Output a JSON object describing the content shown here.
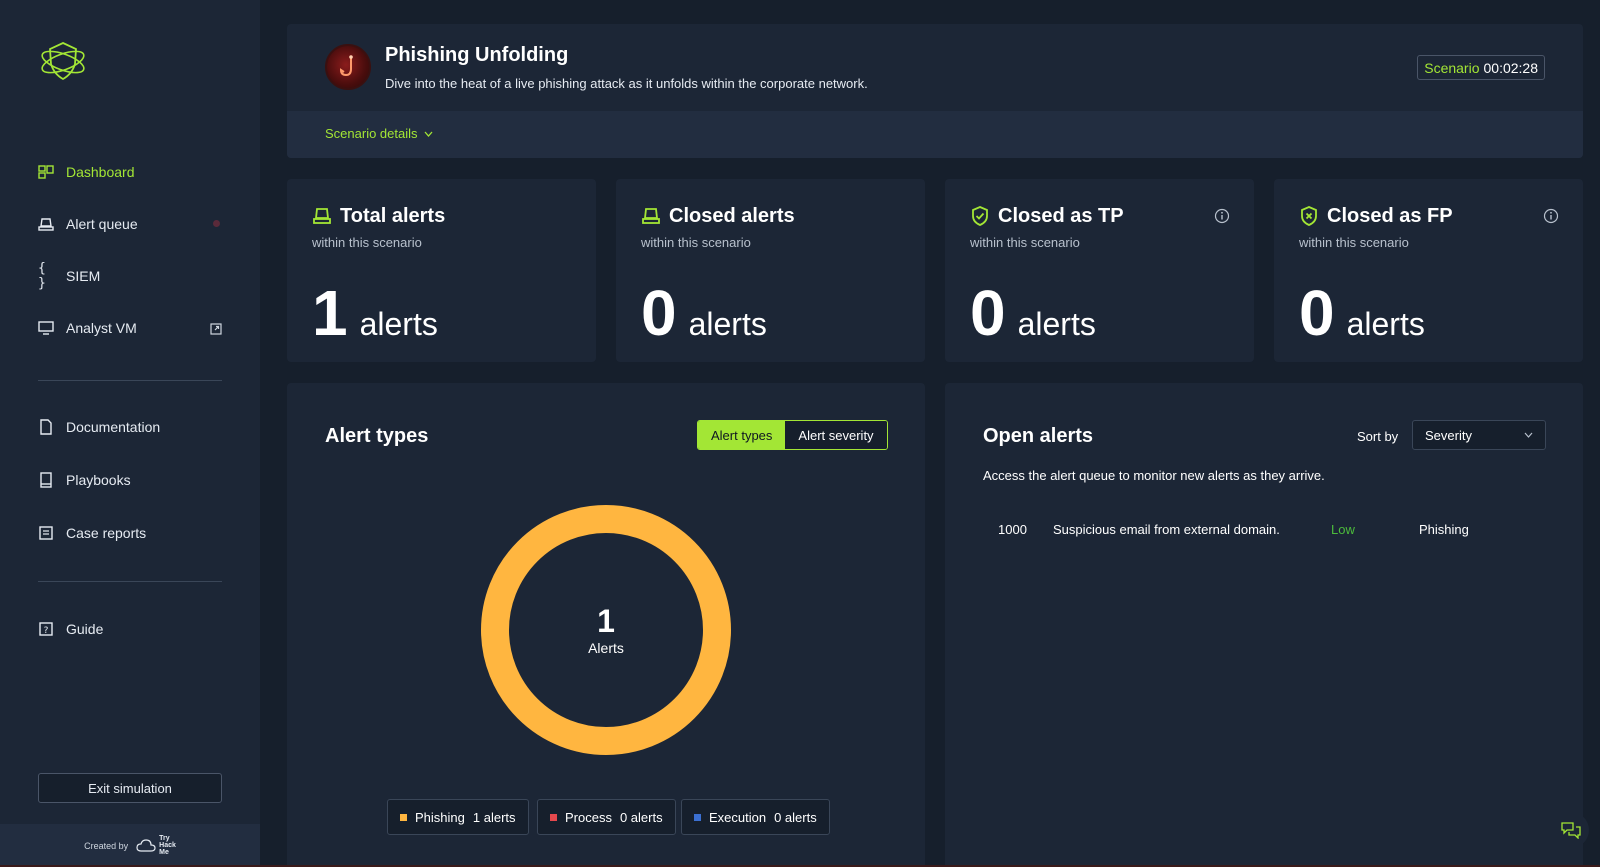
{
  "sidebar": {
    "nav": [
      {
        "label": "Dashboard",
        "icon": "dashboard-icon",
        "active": true
      },
      {
        "label": "Alert queue",
        "icon": "alert-queue-icon"
      },
      {
        "label": "SIEM",
        "icon": "siem-braces-icon"
      },
      {
        "label": "Analyst VM",
        "icon": "monitor-icon"
      }
    ],
    "resources": [
      {
        "label": "Documentation",
        "icon": "document-icon"
      },
      {
        "label": "Playbooks",
        "icon": "book-icon"
      },
      {
        "label": "Case reports",
        "icon": "report-icon"
      }
    ],
    "guide": {
      "label": "Guide",
      "icon": "question-icon"
    },
    "exit_label": "Exit simulation",
    "created_by": "Created by",
    "brand": [
      "Try",
      "Hack",
      "Me"
    ]
  },
  "scenario": {
    "title": "Phishing Unfolding",
    "description": "Dive into the heat of a live phishing attack as it unfolds within the corporate network.",
    "timer_label": "Scenario",
    "timer_value": "00:02:28",
    "details_label": "Scenario details"
  },
  "stats": [
    {
      "title": "Total alerts",
      "subtitle": "within this scenario",
      "value": "1",
      "unit": "alerts"
    },
    {
      "title": "Closed alerts",
      "subtitle": "within this scenario",
      "value": "0",
      "unit": "alerts"
    },
    {
      "title": "Closed as TP",
      "subtitle": "within this scenario",
      "value": "0",
      "unit": "alerts"
    },
    {
      "title": "Closed as FP",
      "subtitle": "within this scenario",
      "value": "0",
      "unit": "alerts"
    }
  ],
  "alert_types": {
    "title": "Alert types",
    "toggle": [
      "Alert types",
      "Alert severity"
    ],
    "center_value": "1",
    "center_label": "Alerts",
    "legend": [
      {
        "name": "Phishing",
        "count": "1 alerts",
        "color": "#ffb640"
      },
      {
        "name": "Process",
        "count": "0 alerts",
        "color": "#e5484d"
      },
      {
        "name": "Execution",
        "count": "0 alerts",
        "color": "#3b6fd1"
      }
    ]
  },
  "chart_data": {
    "type": "pie",
    "categories": [
      "Phishing",
      "Process",
      "Execution"
    ],
    "values": [
      1,
      0,
      0
    ],
    "colors": [
      "#ffb640",
      "#e5484d",
      "#3b6fd1"
    ]
  },
  "open_alerts": {
    "title": "Open alerts",
    "sort_label": "Sort by",
    "sort_value": "Severity",
    "description": "Access the alert queue to monitor new alerts as they arrive.",
    "rows": [
      {
        "id": "1000",
        "title": "Suspicious email from external domain.",
        "severity": "Low",
        "type": "Phishing"
      }
    ]
  },
  "colors": {
    "accent": "#a3e635",
    "bg": "#161f2c",
    "panel": "#1c2636",
    "severity_low": "#4cbb3c"
  }
}
